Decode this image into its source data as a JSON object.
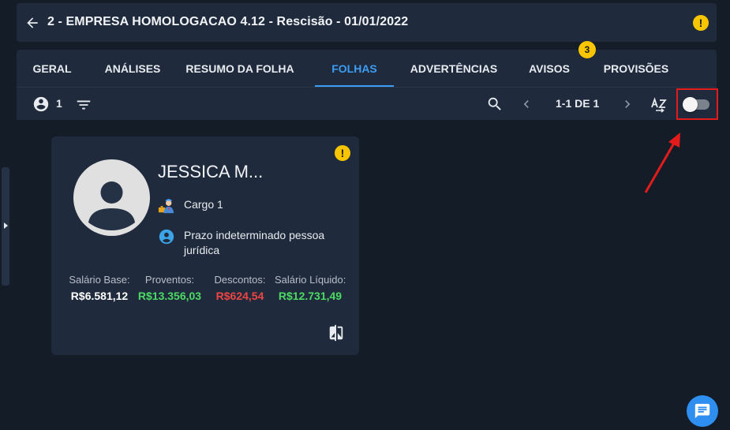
{
  "header": {
    "title": "2 - EMPRESA HOMOLOGACAO 4.12 - Rescisão - 01/01/2022",
    "warning_badge": "!"
  },
  "tabs": [
    {
      "label": "GERAL"
    },
    {
      "label": "ANÁLISES"
    },
    {
      "label": "RESUMO DA FOLHA"
    },
    {
      "label": "FOLHAS",
      "active": true
    },
    {
      "label": "ADVERTÊNCIAS"
    },
    {
      "label": "AVISOS",
      "badge": "3"
    },
    {
      "label": "PROVISÕES"
    }
  ],
  "toolbar": {
    "people_count": "1",
    "pagination": "1-1 DE 1",
    "toggle_on": false
  },
  "employee_card": {
    "warning_badge": "!",
    "name": "JESSICA M...",
    "role": "Cargo 1",
    "contract": "Prazo indeterminado pessoa jurídica",
    "stats": [
      {
        "label": "Salário Base:",
        "value": "R$6.581,12",
        "color": "#ffffff"
      },
      {
        "label": "Proventos:",
        "value": "R$13.356,03",
        "color": "#4cd964"
      },
      {
        "label": "Descontos:",
        "value": "R$624,54",
        "color": "#ef4444"
      },
      {
        "label": "Salário Líquido:",
        "value": "R$12.731,49",
        "color": "#4cd964"
      }
    ]
  },
  "colors": {
    "accent": "#3d9df5",
    "warning": "#f7c600",
    "highlight": "#e31b1b"
  }
}
